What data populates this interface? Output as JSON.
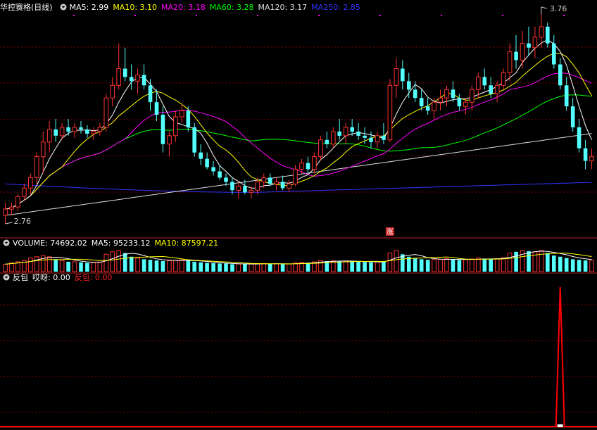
{
  "price_panel": {
    "title": "华控赛格(日线)",
    "ma_labels": [
      {
        "text": "MA5: 2.99",
        "color": "#ffffff"
      },
      {
        "text": "MA10: 3.10",
        "color": "#ffff00"
      },
      {
        "text": "MA20: 3.18",
        "color": "#ff00ff"
      },
      {
        "text": "MA60: 3.28",
        "color": "#00ff00"
      },
      {
        "text": "MA120: 3.17",
        "color": "#dddddd"
      },
      {
        "text": "MA250: 2.85",
        "color": "#3333ff"
      }
    ],
    "high_label": "3.76",
    "low_label": "2.76",
    "zhang_marker": "涨"
  },
  "volume_panel": {
    "name": "VOLUME: 74692.02",
    "ma5": "MA5: 95233.12",
    "ma10": "MA10: 87597.21"
  },
  "indicator_panel": {
    "name": "反包",
    "var1": "哎呀: 0.00",
    "var2": "反包: 0.00"
  },
  "colors": {
    "up": "#ff3232",
    "down": "#54ffff",
    "grid": "#8b0000",
    "frame": "#b22222",
    "signal": "#ff0000"
  },
  "chart_data": {
    "type": "candlestick",
    "price_range": [
      2.76,
      3.76
    ],
    "ohlc": [
      [
        2.8,
        2.86,
        2.76,
        2.83
      ],
      [
        2.83,
        2.86,
        2.8,
        2.84
      ],
      [
        2.84,
        2.9,
        2.82,
        2.89
      ],
      [
        2.89,
        2.95,
        2.87,
        2.93
      ],
      [
        2.93,
        3.0,
        2.9,
        2.98
      ],
      [
        2.98,
        3.1,
        2.95,
        3.08
      ],
      [
        3.08,
        3.2,
        3.0,
        3.15
      ],
      [
        3.15,
        3.25,
        3.1,
        3.21
      ],
      [
        3.21,
        3.26,
        3.15,
        3.18
      ],
      [
        3.18,
        3.24,
        3.16,
        3.22
      ],
      [
        3.22,
        3.26,
        3.18,
        3.2
      ],
      [
        3.2,
        3.24,
        3.17,
        3.22
      ],
      [
        3.22,
        3.25,
        3.19,
        3.21
      ],
      [
        3.21,
        3.23,
        3.17,
        3.19
      ],
      [
        3.19,
        3.22,
        3.16,
        3.2
      ],
      [
        3.2,
        3.24,
        3.18,
        3.22
      ],
      [
        3.22,
        3.38,
        3.2,
        3.36
      ],
      [
        3.36,
        3.46,
        3.32,
        3.42
      ],
      [
        3.42,
        3.62,
        3.4,
        3.5
      ],
      [
        3.5,
        3.6,
        3.44,
        3.46
      ],
      [
        3.46,
        3.52,
        3.4,
        3.44
      ],
      [
        3.44,
        3.5,
        3.38,
        3.47
      ],
      [
        3.47,
        3.52,
        3.4,
        3.42
      ],
      [
        3.42,
        3.45,
        3.3,
        3.34
      ],
      [
        3.34,
        3.4,
        3.25,
        3.28
      ],
      [
        3.28,
        3.32,
        3.1,
        3.14
      ],
      [
        3.14,
        3.2,
        3.08,
        3.18
      ],
      [
        3.18,
        3.3,
        3.15,
        3.27
      ],
      [
        3.27,
        3.33,
        3.24,
        3.3
      ],
      [
        3.3,
        3.32,
        3.2,
        3.22
      ],
      [
        3.22,
        3.24,
        3.08,
        3.1
      ],
      [
        3.1,
        3.14,
        3.04,
        3.07
      ],
      [
        3.07,
        3.1,
        3.02,
        3.03
      ],
      [
        3.03,
        3.06,
        2.99,
        3.01
      ],
      [
        3.01,
        3.04,
        2.97,
        2.98
      ],
      [
        2.98,
        3.0,
        2.94,
        2.96
      ],
      [
        2.96,
        2.98,
        2.9,
        2.92
      ],
      [
        2.92,
        2.96,
        2.88,
        2.94
      ],
      [
        2.94,
        2.97,
        2.9,
        2.91
      ],
      [
        2.91,
        2.94,
        2.88,
        2.92
      ],
      [
        2.92,
        2.98,
        2.9,
        2.96
      ],
      [
        2.96,
        3.0,
        2.93,
        2.98
      ],
      [
        2.98,
        3.0,
        2.94,
        2.95
      ],
      [
        2.95,
        2.98,
        2.92,
        2.96
      ],
      [
        2.96,
        2.99,
        2.92,
        2.93
      ],
      [
        2.93,
        2.97,
        2.91,
        2.95
      ],
      [
        2.95,
        3.04,
        2.94,
        3.02
      ],
      [
        3.02,
        3.07,
        3.0,
        3.05
      ],
      [
        3.05,
        3.08,
        3.0,
        3.02
      ],
      [
        3.02,
        3.1,
        3.0,
        3.08
      ],
      [
        3.08,
        3.18,
        3.06,
        3.16
      ],
      [
        3.16,
        3.2,
        3.12,
        3.14
      ],
      [
        3.14,
        3.22,
        3.12,
        3.2
      ],
      [
        3.2,
        3.26,
        3.16,
        3.18
      ],
      [
        3.18,
        3.24,
        3.14,
        3.22
      ],
      [
        3.22,
        3.26,
        3.18,
        3.2
      ],
      [
        3.2,
        3.24,
        3.16,
        3.18
      ],
      [
        3.18,
        3.22,
        3.14,
        3.17
      ],
      [
        3.17,
        3.2,
        3.12,
        3.15
      ],
      [
        3.15,
        3.2,
        3.12,
        3.18
      ],
      [
        3.18,
        3.24,
        3.14,
        3.16
      ],
      [
        3.16,
        3.45,
        3.15,
        3.42
      ],
      [
        3.42,
        3.55,
        3.36,
        3.5
      ],
      [
        3.5,
        3.54,
        3.4,
        3.44
      ],
      [
        3.44,
        3.48,
        3.36,
        3.4
      ],
      [
        3.4,
        3.44,
        3.34,
        3.36
      ],
      [
        3.36,
        3.4,
        3.3,
        3.32
      ],
      [
        3.32,
        3.36,
        3.28,
        3.3
      ],
      [
        3.3,
        3.36,
        3.26,
        3.34
      ],
      [
        3.34,
        3.4,
        3.3,
        3.36
      ],
      [
        3.36,
        3.42,
        3.32,
        3.4
      ],
      [
        3.4,
        3.44,
        3.34,
        3.36
      ],
      [
        3.36,
        3.38,
        3.3,
        3.32
      ],
      [
        3.32,
        3.36,
        3.28,
        3.34
      ],
      [
        3.34,
        3.42,
        3.3,
        3.4
      ],
      [
        3.4,
        3.48,
        3.36,
        3.46
      ],
      [
        3.46,
        3.5,
        3.4,
        3.42
      ],
      [
        3.42,
        3.46,
        3.36,
        3.38
      ],
      [
        3.38,
        3.44,
        3.34,
        3.42
      ],
      [
        3.42,
        3.5,
        3.4,
        3.48
      ],
      [
        3.48,
        3.62,
        3.44,
        3.58
      ],
      [
        3.58,
        3.66,
        3.5,
        3.54
      ],
      [
        3.54,
        3.68,
        3.5,
        3.62
      ],
      [
        3.62,
        3.7,
        3.56,
        3.6
      ],
      [
        3.6,
        3.7,
        3.55,
        3.65
      ],
      [
        3.65,
        3.76,
        3.6,
        3.7
      ],
      [
        3.7,
        3.72,
        3.6,
        3.62
      ],
      [
        3.62,
        3.66,
        3.5,
        3.52
      ],
      [
        3.52,
        3.55,
        3.4,
        3.42
      ],
      [
        3.42,
        3.46,
        3.3,
        3.32
      ],
      [
        3.32,
        3.36,
        3.2,
        3.22
      ],
      [
        3.22,
        3.26,
        3.1,
        3.12
      ],
      [
        3.12,
        3.16,
        3.02,
        3.06
      ],
      [
        3.06,
        3.12,
        3.02,
        3.08
      ]
    ],
    "volume": [
      60,
      70,
      80,
      90,
      110,
      120,
      130,
      120,
      100,
      90,
      80,
      80,
      75,
      70,
      72,
      78,
      140,
      160,
      170,
      150,
      120,
      110,
      100,
      95,
      90,
      85,
      88,
      92,
      95,
      90,
      80,
      75,
      70,
      68,
      66,
      65,
      60,
      62,
      60,
      62,
      64,
      66,
      62,
      64,
      60,
      62,
      70,
      75,
      72,
      78,
      90,
      85,
      88,
      84,
      86,
      82,
      80,
      78,
      76,
      78,
      80,
      150,
      170,
      140,
      120,
      110,
      100,
      95,
      98,
      100,
      104,
      98,
      94,
      96,
      102,
      110,
      106,
      100,
      104,
      112,
      150,
      160,
      170,
      165,
      160,
      170,
      150,
      130,
      120,
      110,
      100,
      95,
      90,
      92
    ],
    "signal_index": 88
  }
}
